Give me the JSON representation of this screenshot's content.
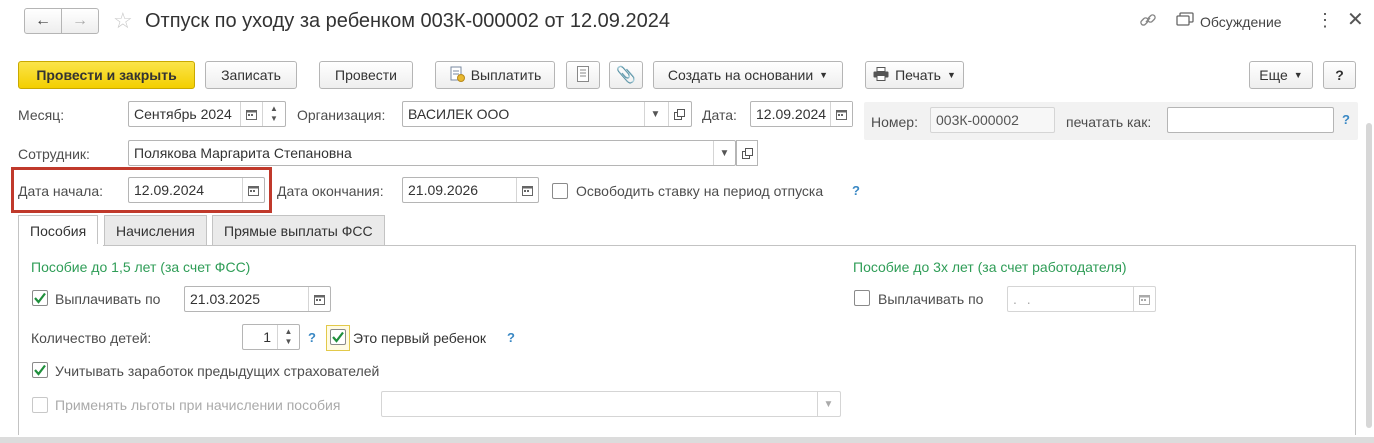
{
  "window": {
    "title": "Отпуск по уходу за ребенком 003К-000002 от 12.09.2024",
    "discussion_label": "Обсуждение"
  },
  "toolbar": {
    "post_and_close": "Провести и закрыть",
    "save": "Записать",
    "post": "Провести",
    "pay": "Выплатить",
    "create_based_on": "Создать на основании",
    "print": "Печать",
    "more": "Еще",
    "help": "?"
  },
  "header": {
    "month_label": "Месяц:",
    "month_value": "Сентябрь 2024",
    "organization_label": "Организация:",
    "organization_value": "ВАСИЛЕК ООО",
    "date_label": "Дата:",
    "date_value": "12.09.2024",
    "number_label": "Номер:",
    "number_value": "003К-000002",
    "print_as_label": "печатать как:",
    "print_as_value": "",
    "employee_label": "Сотрудник:",
    "employee_value": "Полякова Маргарита Степановна",
    "start_label": "Дата начала:",
    "start_value": "12.09.2024",
    "end_label": "Дата окончания:",
    "end_value": "21.09.2026",
    "free_rate_label": "Освободить ставку на период отпуска"
  },
  "tabs": [
    {
      "label": "Пособия"
    },
    {
      "label": "Начисления"
    },
    {
      "label": "Прямые выплаты ФСС"
    }
  ],
  "benefits": {
    "left_title": "Пособие до 1,5 лет (за счет ФСС)",
    "pay_until_label": "Выплачивать по",
    "pay_until_value": "21.03.2025",
    "children_label": "Количество детей:",
    "children_value": "1",
    "first_child_label": "Это первый ребенок",
    "consider_earnings_label": "Учитывать заработок предыдущих страхователей",
    "apply_benefits_label": "Применять льготы при начислении пособия",
    "right_title": "Пособие до 3х лет (за счет работодателя)",
    "right_pay_until_label": "Выплачивать по",
    "right_pay_until_value": " .  ."
  },
  "colors": {
    "accent_yellow": "#f3cf00",
    "green_text": "#2f9d57",
    "highlight_red": "#c0392b",
    "help_blue": "#3a88c4"
  }
}
